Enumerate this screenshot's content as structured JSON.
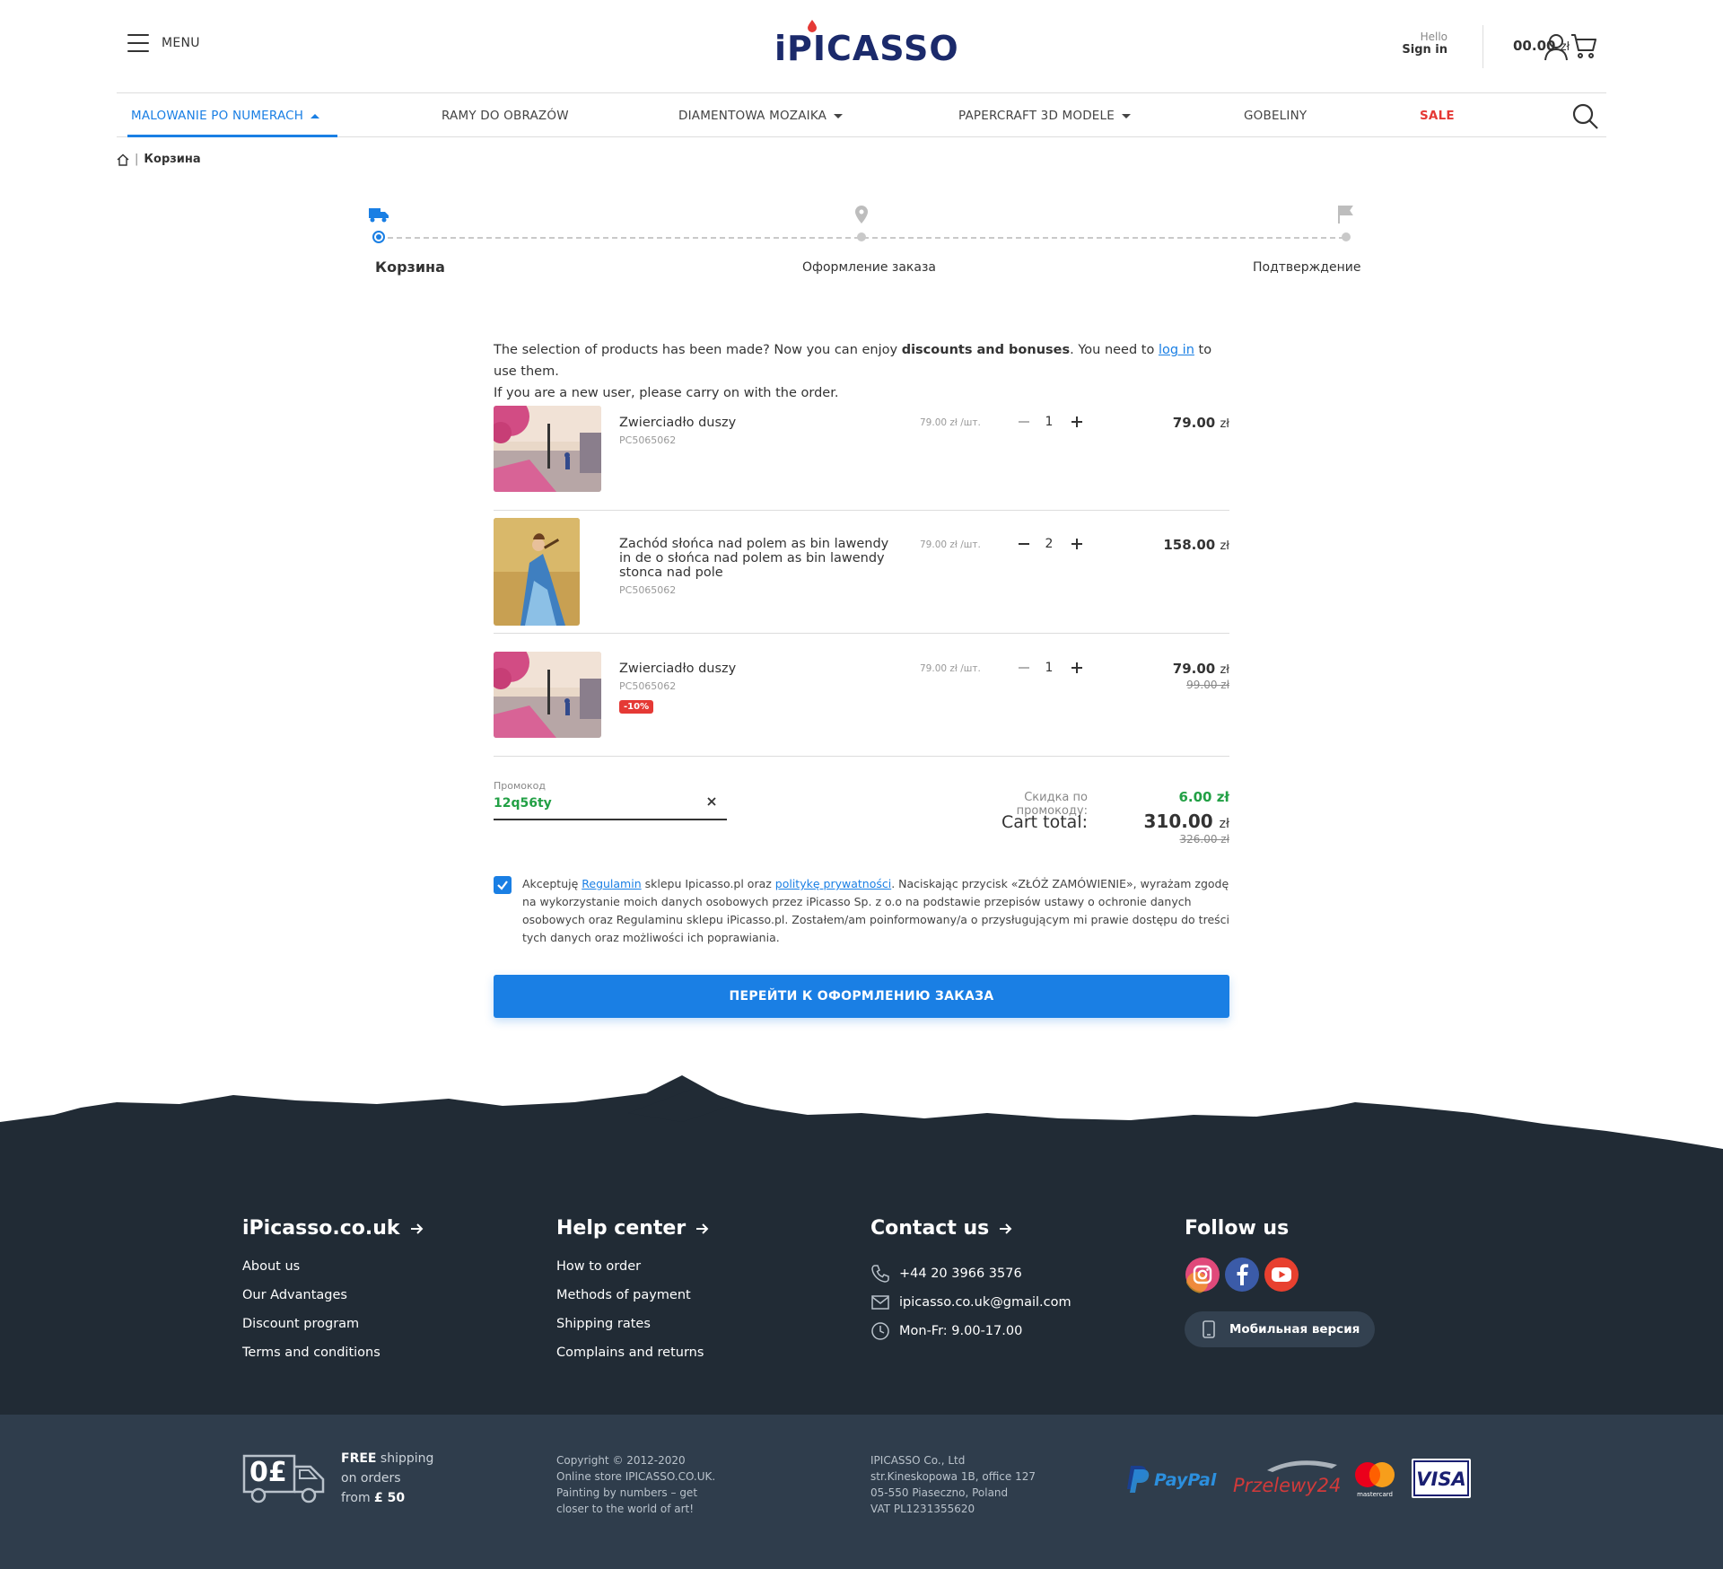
{
  "header": {
    "menu_label": "MENU",
    "logo_text": "iPICASSO",
    "hello": "Hello",
    "sign_in": "Sign in",
    "cart_amount": "00.00",
    "cart_currency": "zł"
  },
  "nav": {
    "items": [
      {
        "label": "MALOWANIE PO NUMERACH"
      },
      {
        "label": "RAMY DO OBRAZÓW"
      },
      {
        "label": "DIAMENTOWA MOZAIKA"
      },
      {
        "label": "PAPERCRAFT 3D MODELE"
      },
      {
        "label": "GOBELINY"
      },
      {
        "label": "SALE"
      }
    ]
  },
  "breadcrumb": {
    "separator": "|",
    "current": "Корзина"
  },
  "stepper": {
    "steps": [
      {
        "label": "Корзина"
      },
      {
        "label": "Оформление заказа"
      },
      {
        "label": "Подтверждение"
      }
    ]
  },
  "intro": {
    "part1": "The selection of products has been made? Now you can enjoy ",
    "bold": "discounts and bonuses",
    "part2": ". You need to ",
    "link": "log in",
    "part3": " to use them.",
    "line2": "If you are a new user, please carry on with the order."
  },
  "cart": {
    "items": [
      {
        "name": "Zwierciadło duszy",
        "sku": "PC5065062",
        "unit_price": "79.00 zł /шт.",
        "qty": "1",
        "price": "79.00",
        "currency": "zł"
      },
      {
        "name": "Zachód słońca nad polem as bin lawendy in de o słońca nad polem as bin lawendy stonca nad pole",
        "sku": "PC5065062",
        "unit_price": "79.00 zł /шт.",
        "qty": "2",
        "price": "158.00",
        "currency": "zł"
      },
      {
        "name": "Zwierciadło duszy",
        "sku": "PC5065062",
        "unit_price": "79.00 zł /шт.",
        "qty": "1",
        "price": "79.00",
        "currency": "zł",
        "old_price": "99.00 zł",
        "badge": "-10%"
      }
    ]
  },
  "promo": {
    "label": "Промокод",
    "value": "12q56ty",
    "discount_label": "Скидка по промокоду:",
    "discount_value": "6.00 zł",
    "total_label": "Cart total:",
    "total_value": "310.00",
    "total_currency": "zł",
    "total_old": "326.00 zł"
  },
  "terms": {
    "part1": "Akceptuję ",
    "link1": "Regulamin",
    "part2": " sklepu Ipicasso.pl oraz ",
    "link2": "politykę prywatności",
    "part3": ". Naciskając przycisk «ZŁÓŻ ZAMÓWIENIE», wyrażam zgodę na wykorzystanie moich danych osobowych przez iPicasso Sp. z o.o na podstawie przepisów ustawy o ochronie danych osobowych oraz Regulaminu sklepu iPicasso.pl. Zostałem/am poinformowany/a o przysługującym mi prawie dostępu do treści tych danych oraz możliwości ich poprawiania."
  },
  "cta_label": "ПЕРЕЙТИ К ОФОРМЛЕНИЮ ЗАКАЗА",
  "footer": {
    "col1": {
      "title": "iPicasso.co.uk",
      "links": [
        "About us",
        "Our Advantages",
        "Discount program",
        "Terms and conditions"
      ]
    },
    "col2": {
      "title": "Help center",
      "links": [
        "How to order",
        "Methods of payment",
        "Shipping rates",
        "Complains and returns"
      ]
    },
    "col3": {
      "title": "Contact us",
      "phone": "+44 20 3966 3576",
      "email": "ipicasso.co.uk@gmail.com",
      "hours": "Mon-Fr: 9.00-17.00"
    },
    "col4": {
      "title": "Follow us",
      "mobile_label": "Мобильная версия"
    },
    "shipping": {
      "icon_text": "0£",
      "free": "FREE",
      "line1_rest": " shipping",
      "line2": "on orders",
      "line3_pre": "from ",
      "line3_amount": "£ 50"
    },
    "copyright": {
      "l1": "Copyright © 2012-2020",
      "l2": "Online store IPICASSO.CO.UK.",
      "l3": "Painting by numbers – get",
      "l4": "closer to the world of art!"
    },
    "company": {
      "l1": "IPICASSO Co., Ltd",
      "l2": "str.Kineskopowa 1B, office 127",
      "l3": "05-550 Piaseczno, Poland",
      "l4": "VAT PL1231355620"
    },
    "payments": {
      "paypal": "PayPal",
      "p24": "Przelewy24",
      "mastercard": "mastercard",
      "visa": "VISA"
    }
  },
  "colors": {
    "accent": "#1a7fe4",
    "sale": "#e53935",
    "success": "#22a045",
    "footer_dark": "#212b35",
    "footer_bottom": "#2f3d4c"
  }
}
